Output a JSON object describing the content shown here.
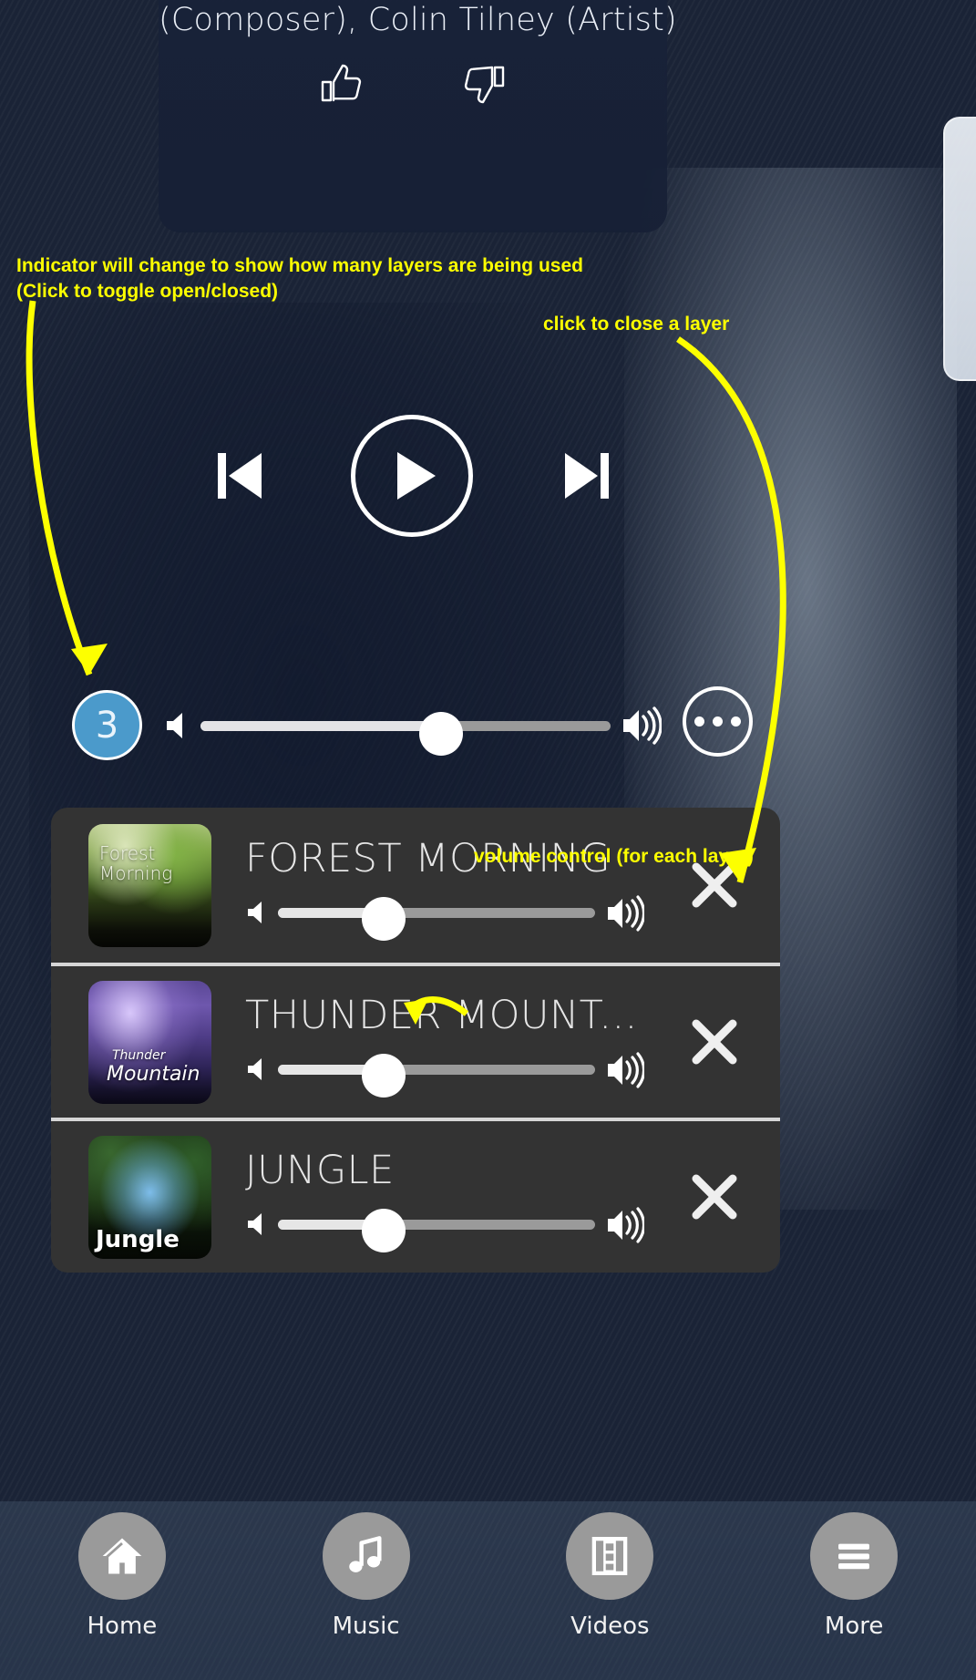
{
  "now_playing": {
    "title": "(Composer), Colin Tilney (Artist)",
    "like_icon": "thumbs-up-icon",
    "dislike_icon": "thumbs-down-icon"
  },
  "transport": {
    "previous_icon": "skip-previous-icon",
    "play_icon": "play-icon",
    "next_icon": "skip-next-icon"
  },
  "main_volume": {
    "layer_count": "3",
    "layer_count_color": "#4b9acb",
    "mute_icon": "volume-low-icon",
    "loud_icon": "volume-high-icon",
    "more_icon": "more-options-icon",
    "value_percent": 59
  },
  "layers_panel": {
    "background_color": "#333333",
    "rows": [
      {
        "name": "FOREST MORNING",
        "thumb_label_line1": "Forest",
        "thumb_label_line2": "Morning",
        "thumb_name": "forest-morning-artwork",
        "volume_percent": 33,
        "close_icon": "close-icon"
      },
      {
        "name": "THUNDER MOUNT...",
        "thumb_label_line1": "Thunder",
        "thumb_label_line2": "Mountain",
        "thumb_name": "thunder-mountain-artwork",
        "volume_percent": 33,
        "close_icon": "close-icon"
      },
      {
        "name": "JUNGLE",
        "thumb_label_line1": "Jungle",
        "thumb_label_line2": "",
        "thumb_name": "jungle-artwork",
        "volume_percent": 33,
        "close_icon": "close-icon"
      }
    ]
  },
  "annotations": {
    "color": "#fdff00",
    "indicator": "Indicator will change to show how many layers are being used\n(Click to toggle open/closed)",
    "close_layer": "click to close a layer",
    "volume_control": "volume control (for each layer)"
  },
  "bottom_nav": {
    "items": [
      {
        "label": "Home",
        "icon": "home-icon"
      },
      {
        "label": "Music",
        "icon": "music-note-icon"
      },
      {
        "label": "Videos",
        "icon": "film-strip-icon"
      },
      {
        "label": "More",
        "icon": "hamburger-menu-icon"
      }
    ]
  }
}
